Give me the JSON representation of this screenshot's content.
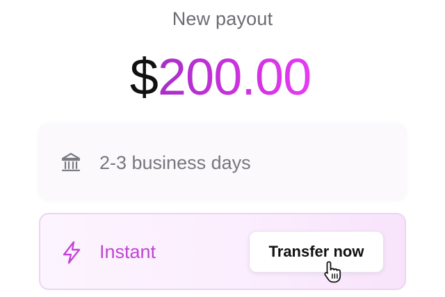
{
  "header": {
    "title": "New payout"
  },
  "amount": {
    "currency": "$",
    "value": "200.00"
  },
  "options": {
    "standard": {
      "label": "2-3 business days",
      "icon": "bank-icon"
    },
    "instant": {
      "label": "Instant",
      "icon": "lightning-bolt-icon",
      "button_label": "Transfer now"
    }
  },
  "colors": {
    "accent": "#c63ddb",
    "accent_gradient_start": "#a62fc7",
    "accent_gradient_end": "#e53bf5",
    "instant_bg": "#fbeefe",
    "instant_border": "#ecd4f4",
    "muted_text": "#76767d"
  },
  "cursor": {
    "icon": "hand-pointer-cursor-icon"
  }
}
